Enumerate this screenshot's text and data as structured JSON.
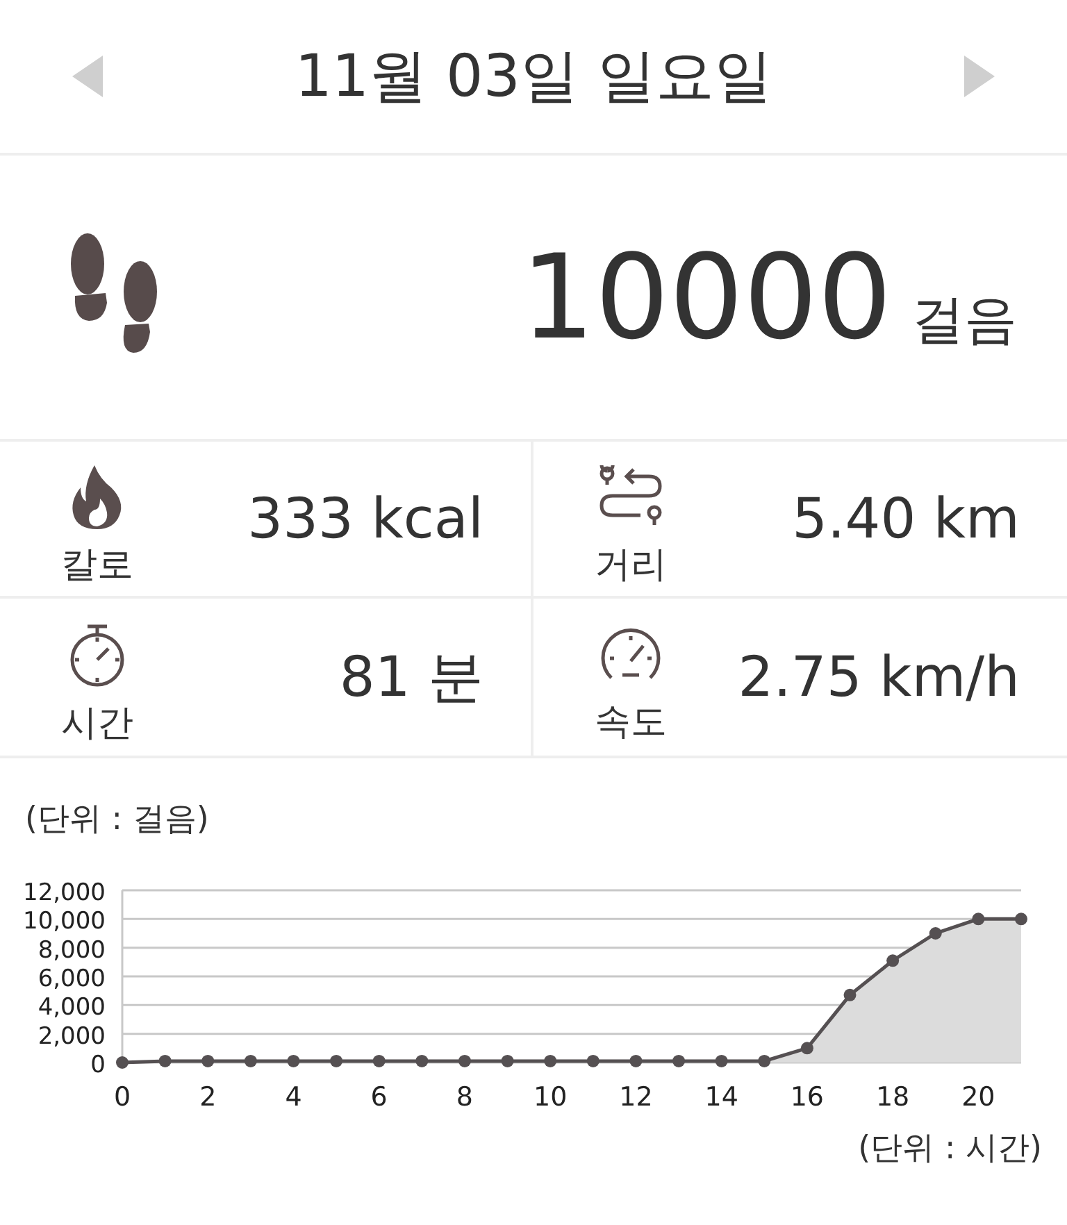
{
  "header": {
    "date": "11월 03일 일요일"
  },
  "steps": {
    "value": "10000",
    "unit": "걸음"
  },
  "stats": [
    {
      "kind": "calories",
      "label": "칼로",
      "value": "333 kcal"
    },
    {
      "kind": "distance",
      "label": "거리",
      "value": "5.40 km"
    },
    {
      "kind": "time",
      "label": "시간",
      "value": "81 분"
    },
    {
      "kind": "speed",
      "label": "속도",
      "value": "2.75 km/h"
    }
  ],
  "chart": {
    "unit_y": "(단위 : 걸음)",
    "unit_x": "(단위 : 시간)",
    "chart_data": {
      "type": "area",
      "x": [
        0,
        1,
        2,
        3,
        4,
        5,
        6,
        7,
        8,
        9,
        10,
        11,
        12,
        13,
        14,
        15,
        16,
        17,
        18,
        19,
        20,
        21
      ],
      "series": [
        {
          "color": "#555052",
          "values": [
            0,
            100,
            100,
            100,
            100,
            100,
            100,
            100,
            100,
            100,
            100,
            100,
            100,
            100,
            100,
            100,
            1000,
            4700,
            7100,
            9000,
            10000,
            10000
          ]
        }
      ],
      "grid": true,
      "xlim": [
        0,
        21
      ],
      "ylim": [
        0,
        12000
      ],
      "xticks": [
        0,
        2,
        4,
        6,
        8,
        10,
        12,
        14,
        16,
        18,
        20
      ],
      "yticks": [
        {
          "value": 0,
          "label": "0"
        },
        {
          "value": 2000,
          "label": "2,000"
        },
        {
          "value": 4000,
          "label": "4,000"
        },
        {
          "value": 6000,
          "label": "6,000"
        },
        {
          "value": 8000,
          "label": "8,000"
        },
        {
          "value": 10000,
          "label": "10,000"
        },
        {
          "value": 12000,
          "label": "12,000"
        }
      ]
    }
  }
}
